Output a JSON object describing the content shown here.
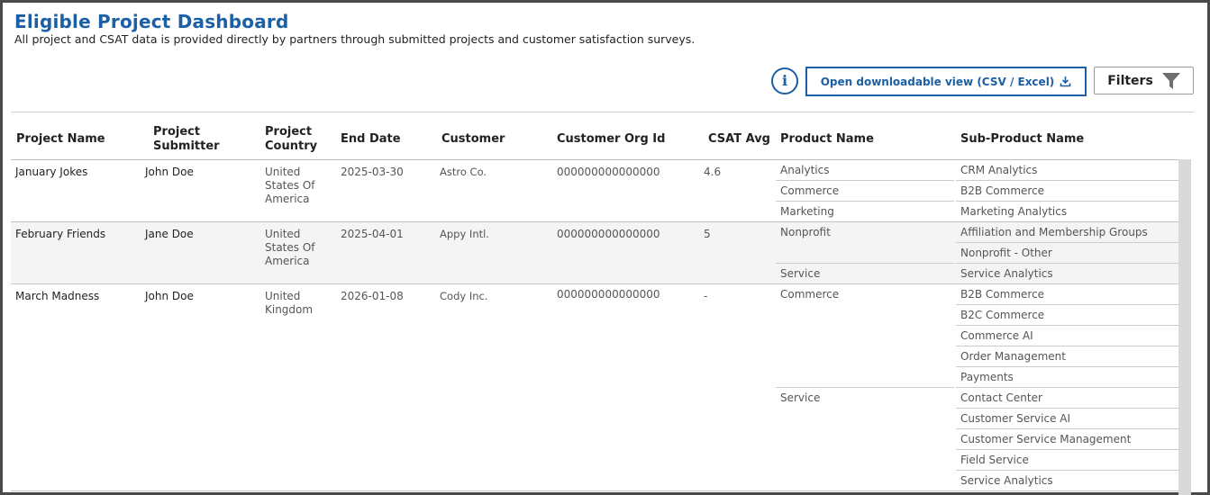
{
  "page": {
    "title": "Eligible Project Dashboard",
    "subtitle": "All project and CSAT data is provided directly by partners through submitted projects and customer satisfaction surveys."
  },
  "toolbar": {
    "info_label": "i",
    "download_label": "Open downloadable view (CSV / Excel)",
    "filters_label": "Filters",
    "accent_color": "#1b5fa6"
  },
  "table": {
    "headers": {
      "project_name": "Project Name",
      "project_submitter": "Project Submitter",
      "project_country": "Project Country",
      "end_date": "End Date",
      "customer": "Customer",
      "customer_org_id": "Customer Org Id",
      "csat_avg": "CSAT Avg",
      "product_name": "Product Name",
      "sub_product_name": "Sub-Product Name"
    },
    "rows": [
      {
        "project_name": "January Jokes",
        "submitter": "John Doe",
        "country": "United States Of America",
        "end_date": "2025-03-30",
        "customer": "Astro Co.",
        "org_id": "000000000000000",
        "csat": "4.6",
        "products": [
          {
            "name": "Analytics",
            "subs": [
              "CRM Analytics"
            ]
          },
          {
            "name": "Commerce",
            "subs": [
              "B2B Commerce"
            ]
          },
          {
            "name": "Marketing",
            "subs": [
              "Marketing Analytics"
            ]
          }
        ]
      },
      {
        "project_name": "February Friends",
        "submitter": "Jane Doe",
        "country": "United States Of America",
        "end_date": "2025-04-01",
        "customer": "Appy Intl.",
        "org_id": "000000000000000",
        "csat": "5",
        "products": [
          {
            "name": "Nonprofit",
            "subs": [
              "Affiliation and Membership Groups",
              "Nonprofit - Other"
            ]
          },
          {
            "name": "Service",
            "subs": [
              "Service Analytics"
            ]
          }
        ]
      },
      {
        "project_name": "March Madness",
        "submitter": "John Doe",
        "country": "United Kingdom",
        "end_date": "2026-01-08",
        "customer": "Cody Inc.",
        "org_id": "000000000000000",
        "csat": "-",
        "products": [
          {
            "name": "Commerce",
            "subs": [
              "B2B Commerce",
              "B2C Commerce",
              "Commerce AI",
              "Order Management",
              "Payments"
            ]
          },
          {
            "name": "Service",
            "subs": [
              "Contact Center",
              "Customer Service AI",
              "Customer Service Management",
              "Field Service",
              "Service Analytics"
            ]
          }
        ]
      }
    ]
  },
  "colors": {
    "title": "#1b5fa6",
    "row_alt_bg": "#f4f4f4",
    "scrollbar": "#d9d9d9"
  }
}
